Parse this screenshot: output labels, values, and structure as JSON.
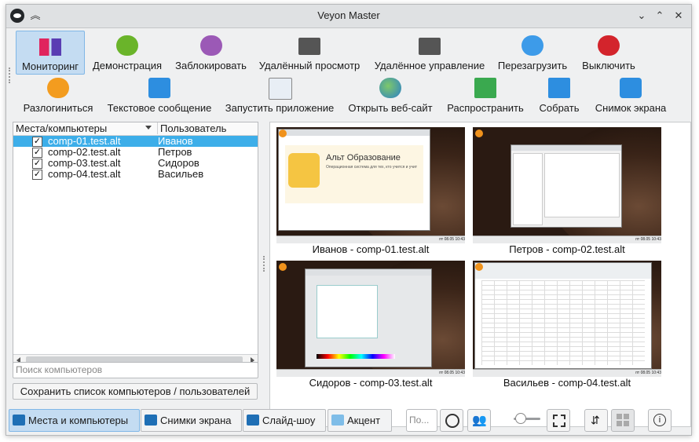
{
  "window": {
    "title": "Veyon Master"
  },
  "toolbar": {
    "row1": [
      {
        "label": "Мониторинг",
        "icon": "monitoring-icon",
        "active": true
      },
      {
        "label": "Демонстрация",
        "icon": "presentation-icon"
      },
      {
        "label": "Заблокировать",
        "icon": "lock-icon"
      },
      {
        "label": "Удалённый просмотр",
        "icon": "remote-view-icon"
      },
      {
        "label": "Удалённое управление",
        "icon": "remote-control-icon"
      },
      {
        "label": "Перезагрузить",
        "icon": "reboot-icon"
      },
      {
        "label": "Выключить",
        "icon": "power-icon"
      }
    ],
    "row2": [
      {
        "label": "Разлогиниться",
        "icon": "logout-icon"
      },
      {
        "label": "Текстовое сообщение",
        "icon": "message-icon"
      },
      {
        "label": "Запустить приложение",
        "icon": "run-program-icon"
      },
      {
        "label": "Открыть веб-сайт",
        "icon": "globe-icon"
      },
      {
        "label": "Распространить",
        "icon": "distribute-icon"
      },
      {
        "label": "Собрать",
        "icon": "collect-icon"
      },
      {
        "label": "Снимок экрана",
        "icon": "camera-icon"
      }
    ]
  },
  "computers": {
    "header_location": "Места/компьютеры",
    "header_user": "Пользователь",
    "rows": [
      {
        "host": "comp-01.test.alt",
        "user": "Иванов",
        "checked": true,
        "selected": true
      },
      {
        "host": "comp-02.test.alt",
        "user": "Петров",
        "checked": true
      },
      {
        "host": "comp-03.test.alt",
        "user": "Сидоров",
        "checked": true
      },
      {
        "host": "comp-04.test.alt",
        "user": "Васильев",
        "checked": true
      }
    ],
    "search_placeholder": "Поиск компьютеров",
    "save_label": "Сохранить список компьютеров / пользователей"
  },
  "tiles": [
    {
      "caption": "Иванов - comp-01.test.alt",
      "screen": "browser",
      "page_title": "Альт Образование",
      "page_sub": "Операционная система для тех, кто учится и учит",
      "clock": "пт 08.05 10:43"
    },
    {
      "caption": "Петров - comp-02.test.alt",
      "screen": "dialog",
      "clock": "пт 08.05 10:43"
    },
    {
      "caption": "Сидоров - comp-03.test.alt",
      "screen": "paint",
      "clock": "пт 08.05 10:43"
    },
    {
      "caption": "Васильев - comp-04.test.alt",
      "screen": "sheet",
      "clock": "пт 08.05 10:43"
    }
  ],
  "bottom": {
    "tabs": [
      {
        "label": "Места и компьютеры",
        "active": true
      },
      {
        "label": "Снимки экрана"
      },
      {
        "label": "Слайд-шоу"
      },
      {
        "label": "Акцент"
      }
    ],
    "filter_placeholder": "По..."
  },
  "colors": {
    "accent": "#3daee9",
    "active_tab": "#c4dcf2"
  }
}
